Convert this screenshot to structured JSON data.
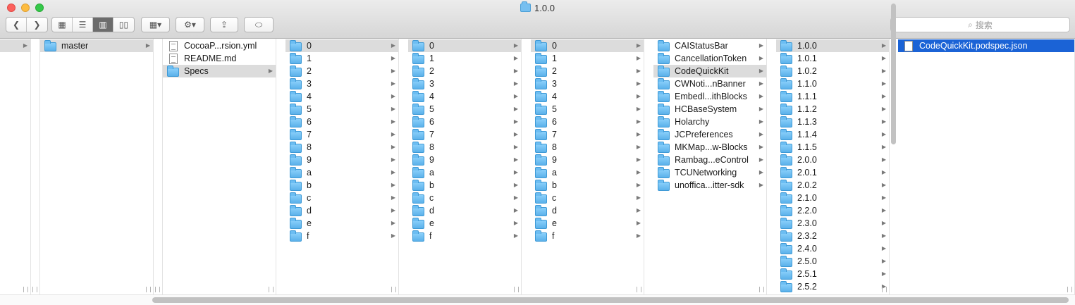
{
  "window": {
    "title": "1.0.0"
  },
  "toolbar": {
    "back_label": "❮",
    "forward_label": "❯",
    "view_icons": "▦",
    "view_list": "☰",
    "view_columns": "▥",
    "view_coverflow": "▯▯",
    "arrange_label": "▦▾",
    "action_label": "⚙▾",
    "share_label": "⇪",
    "tags_label": "⬭",
    "search_placeholder": "搜索"
  },
  "columns": [
    {
      "items": [
        {
          "name": "",
          "type": "none",
          "arrow": true,
          "state": "selected"
        }
      ]
    },
    {
      "items": [
        {
          "name": "master",
          "type": "folder",
          "arrow": true,
          "state": "selected"
        }
      ]
    },
    {
      "items": [
        {
          "name": "CocoaP...rsion.yml",
          "type": "doc",
          "arrow": false,
          "state": ""
        },
        {
          "name": "README.md",
          "type": "doc-md",
          "arrow": false,
          "state": ""
        },
        {
          "name": "Specs",
          "type": "folder",
          "arrow": true,
          "state": "selected"
        }
      ]
    },
    {
      "items": [
        {
          "name": "0",
          "type": "folder",
          "arrow": true,
          "state": "selected"
        },
        {
          "name": "1",
          "type": "folder",
          "arrow": true,
          "state": ""
        },
        {
          "name": "2",
          "type": "folder",
          "arrow": true,
          "state": ""
        },
        {
          "name": "3",
          "type": "folder",
          "arrow": true,
          "state": ""
        },
        {
          "name": "4",
          "type": "folder",
          "arrow": true,
          "state": ""
        },
        {
          "name": "5",
          "type": "folder",
          "arrow": true,
          "state": ""
        },
        {
          "name": "6",
          "type": "folder",
          "arrow": true,
          "state": ""
        },
        {
          "name": "7",
          "type": "folder",
          "arrow": true,
          "state": ""
        },
        {
          "name": "8",
          "type": "folder",
          "arrow": true,
          "state": ""
        },
        {
          "name": "9",
          "type": "folder",
          "arrow": true,
          "state": ""
        },
        {
          "name": "a",
          "type": "folder",
          "arrow": true,
          "state": ""
        },
        {
          "name": "b",
          "type": "folder",
          "arrow": true,
          "state": ""
        },
        {
          "name": "c",
          "type": "folder",
          "arrow": true,
          "state": ""
        },
        {
          "name": "d",
          "type": "folder",
          "arrow": true,
          "state": ""
        },
        {
          "name": "e",
          "type": "folder",
          "arrow": true,
          "state": ""
        },
        {
          "name": "f",
          "type": "folder",
          "arrow": true,
          "state": ""
        }
      ]
    },
    {
      "items": [
        {
          "name": "0",
          "type": "folder",
          "arrow": true,
          "state": "selected"
        },
        {
          "name": "1",
          "type": "folder",
          "arrow": true,
          "state": ""
        },
        {
          "name": "2",
          "type": "folder",
          "arrow": true,
          "state": ""
        },
        {
          "name": "3",
          "type": "folder",
          "arrow": true,
          "state": ""
        },
        {
          "name": "4",
          "type": "folder",
          "arrow": true,
          "state": ""
        },
        {
          "name": "5",
          "type": "folder",
          "arrow": true,
          "state": ""
        },
        {
          "name": "6",
          "type": "folder",
          "arrow": true,
          "state": ""
        },
        {
          "name": "7",
          "type": "folder",
          "arrow": true,
          "state": ""
        },
        {
          "name": "8",
          "type": "folder",
          "arrow": true,
          "state": ""
        },
        {
          "name": "9",
          "type": "folder",
          "arrow": true,
          "state": ""
        },
        {
          "name": "a",
          "type": "folder",
          "arrow": true,
          "state": ""
        },
        {
          "name": "b",
          "type": "folder",
          "arrow": true,
          "state": ""
        },
        {
          "name": "c",
          "type": "folder",
          "arrow": true,
          "state": ""
        },
        {
          "name": "d",
          "type": "folder",
          "arrow": true,
          "state": ""
        },
        {
          "name": "e",
          "type": "folder",
          "arrow": true,
          "state": ""
        },
        {
          "name": "f",
          "type": "folder",
          "arrow": true,
          "state": ""
        }
      ]
    },
    {
      "items": [
        {
          "name": "0",
          "type": "folder",
          "arrow": true,
          "state": "selected"
        },
        {
          "name": "1",
          "type": "folder",
          "arrow": true,
          "state": ""
        },
        {
          "name": "2",
          "type": "folder",
          "arrow": true,
          "state": ""
        },
        {
          "name": "3",
          "type": "folder",
          "arrow": true,
          "state": ""
        },
        {
          "name": "4",
          "type": "folder",
          "arrow": true,
          "state": ""
        },
        {
          "name": "5",
          "type": "folder",
          "arrow": true,
          "state": ""
        },
        {
          "name": "6",
          "type": "folder",
          "arrow": true,
          "state": ""
        },
        {
          "name": "7",
          "type": "folder",
          "arrow": true,
          "state": ""
        },
        {
          "name": "8",
          "type": "folder",
          "arrow": true,
          "state": ""
        },
        {
          "name": "9",
          "type": "folder",
          "arrow": true,
          "state": ""
        },
        {
          "name": "a",
          "type": "folder",
          "arrow": true,
          "state": ""
        },
        {
          "name": "b",
          "type": "folder",
          "arrow": true,
          "state": ""
        },
        {
          "name": "c",
          "type": "folder",
          "arrow": true,
          "state": ""
        },
        {
          "name": "d",
          "type": "folder",
          "arrow": true,
          "state": ""
        },
        {
          "name": "e",
          "type": "folder",
          "arrow": true,
          "state": ""
        },
        {
          "name": "f",
          "type": "folder",
          "arrow": true,
          "state": ""
        }
      ]
    },
    {
      "items": [
        {
          "name": "CAIStatusBar",
          "type": "folder",
          "arrow": true,
          "state": ""
        },
        {
          "name": "CancellationToken",
          "type": "folder",
          "arrow": true,
          "state": ""
        },
        {
          "name": "CodeQuickKit",
          "type": "folder",
          "arrow": true,
          "state": "selected"
        },
        {
          "name": "CWNoti...nBanner",
          "type": "folder",
          "arrow": true,
          "state": ""
        },
        {
          "name": "Embedl...ithBlocks",
          "type": "folder",
          "arrow": true,
          "state": ""
        },
        {
          "name": "HCBaseSystem",
          "type": "folder",
          "arrow": true,
          "state": ""
        },
        {
          "name": "Holarchy",
          "type": "folder",
          "arrow": true,
          "state": ""
        },
        {
          "name": "JCPreferences",
          "type": "folder",
          "arrow": true,
          "state": ""
        },
        {
          "name": "MKMap...w-Blocks",
          "type": "folder",
          "arrow": true,
          "state": ""
        },
        {
          "name": "Rambag...eControl",
          "type": "folder",
          "arrow": true,
          "state": ""
        },
        {
          "name": "TCUNetworking",
          "type": "folder",
          "arrow": true,
          "state": ""
        },
        {
          "name": "unoffica...itter-sdk",
          "type": "folder",
          "arrow": true,
          "state": ""
        }
      ]
    },
    {
      "items": [
        {
          "name": "1.0.0",
          "type": "folder",
          "arrow": true,
          "state": "selected"
        },
        {
          "name": "1.0.1",
          "type": "folder",
          "arrow": true,
          "state": ""
        },
        {
          "name": "1.0.2",
          "type": "folder",
          "arrow": true,
          "state": ""
        },
        {
          "name": "1.1.0",
          "type": "folder",
          "arrow": true,
          "state": ""
        },
        {
          "name": "1.1.1",
          "type": "folder",
          "arrow": true,
          "state": ""
        },
        {
          "name": "1.1.2",
          "type": "folder",
          "arrow": true,
          "state": ""
        },
        {
          "name": "1.1.3",
          "type": "folder",
          "arrow": true,
          "state": ""
        },
        {
          "name": "1.1.4",
          "type": "folder",
          "arrow": true,
          "state": ""
        },
        {
          "name": "1.1.5",
          "type": "folder",
          "arrow": true,
          "state": ""
        },
        {
          "name": "2.0.0",
          "type": "folder",
          "arrow": true,
          "state": ""
        },
        {
          "name": "2.0.1",
          "type": "folder",
          "arrow": true,
          "state": ""
        },
        {
          "name": "2.0.2",
          "type": "folder",
          "arrow": true,
          "state": ""
        },
        {
          "name": "2.1.0",
          "type": "folder",
          "arrow": true,
          "state": ""
        },
        {
          "name": "2.2.0",
          "type": "folder",
          "arrow": true,
          "state": ""
        },
        {
          "name": "2.3.0",
          "type": "folder",
          "arrow": true,
          "state": ""
        },
        {
          "name": "2.3.2",
          "type": "folder",
          "arrow": true,
          "state": ""
        },
        {
          "name": "2.4.0",
          "type": "folder",
          "arrow": true,
          "state": ""
        },
        {
          "name": "2.5.0",
          "type": "folder",
          "arrow": true,
          "state": ""
        },
        {
          "name": "2.5.1",
          "type": "folder",
          "arrow": true,
          "state": ""
        },
        {
          "name": "2.5.2",
          "type": "folder",
          "arrow": true,
          "state": ""
        }
      ]
    },
    {
      "items": [
        {
          "name": "CodeQuickKit.podspec.json",
          "type": "doc-blank",
          "arrow": false,
          "state": "active"
        }
      ]
    }
  ]
}
